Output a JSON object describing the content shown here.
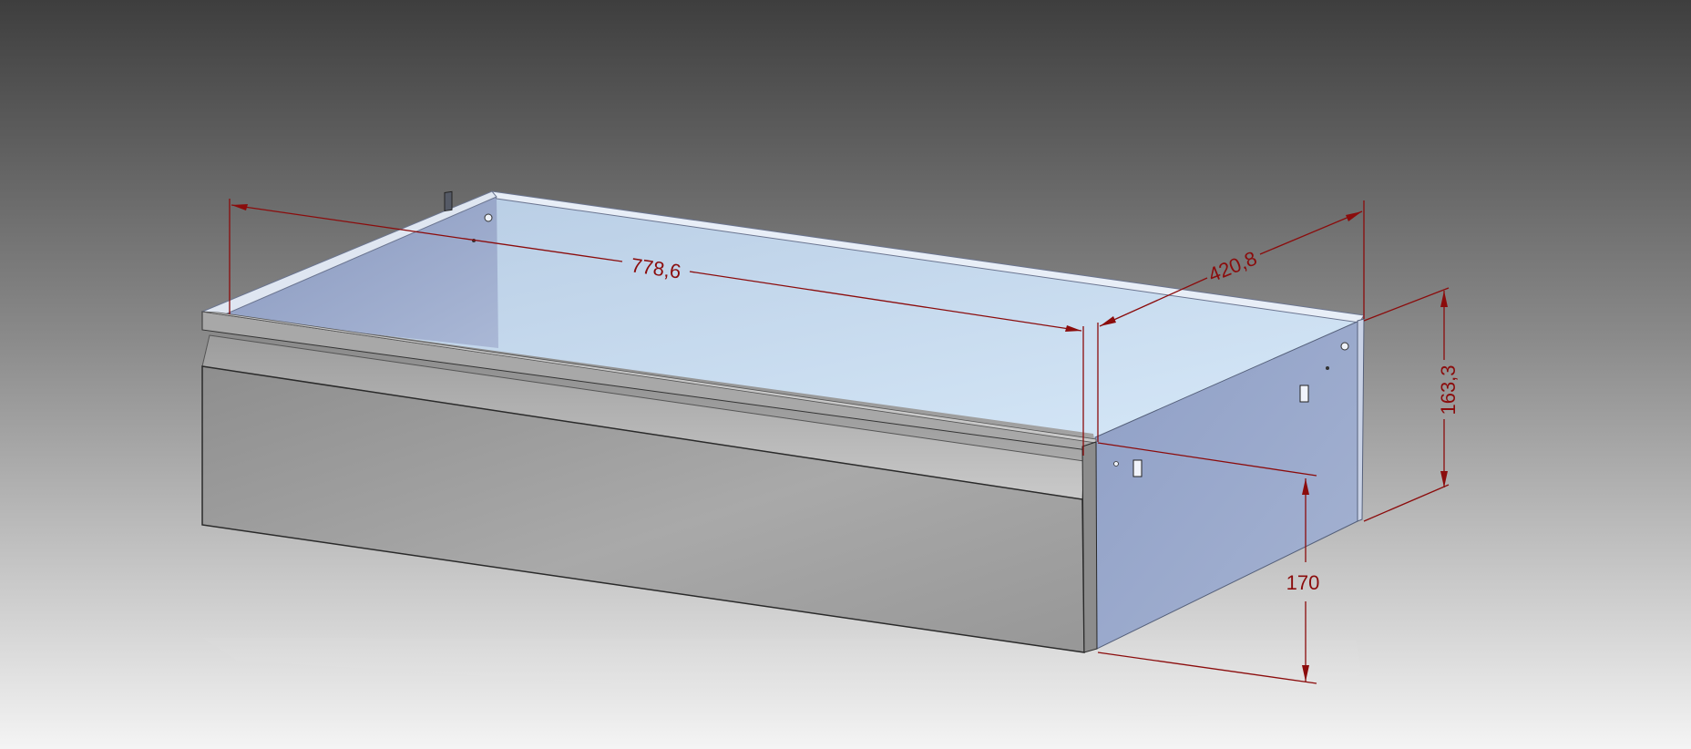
{
  "dimensions": {
    "length": "778,6",
    "depth": "420,8",
    "side_height": "163,3",
    "front_height": "170"
  },
  "colors": {
    "dimension_line": "#8b0c0c",
    "background_top": "#3e3e3e",
    "background_bottom": "#f2f2f2",
    "interior": "#c7dbef",
    "front_panel": "#a6a6a6",
    "side_panel": "#96a7ca"
  }
}
